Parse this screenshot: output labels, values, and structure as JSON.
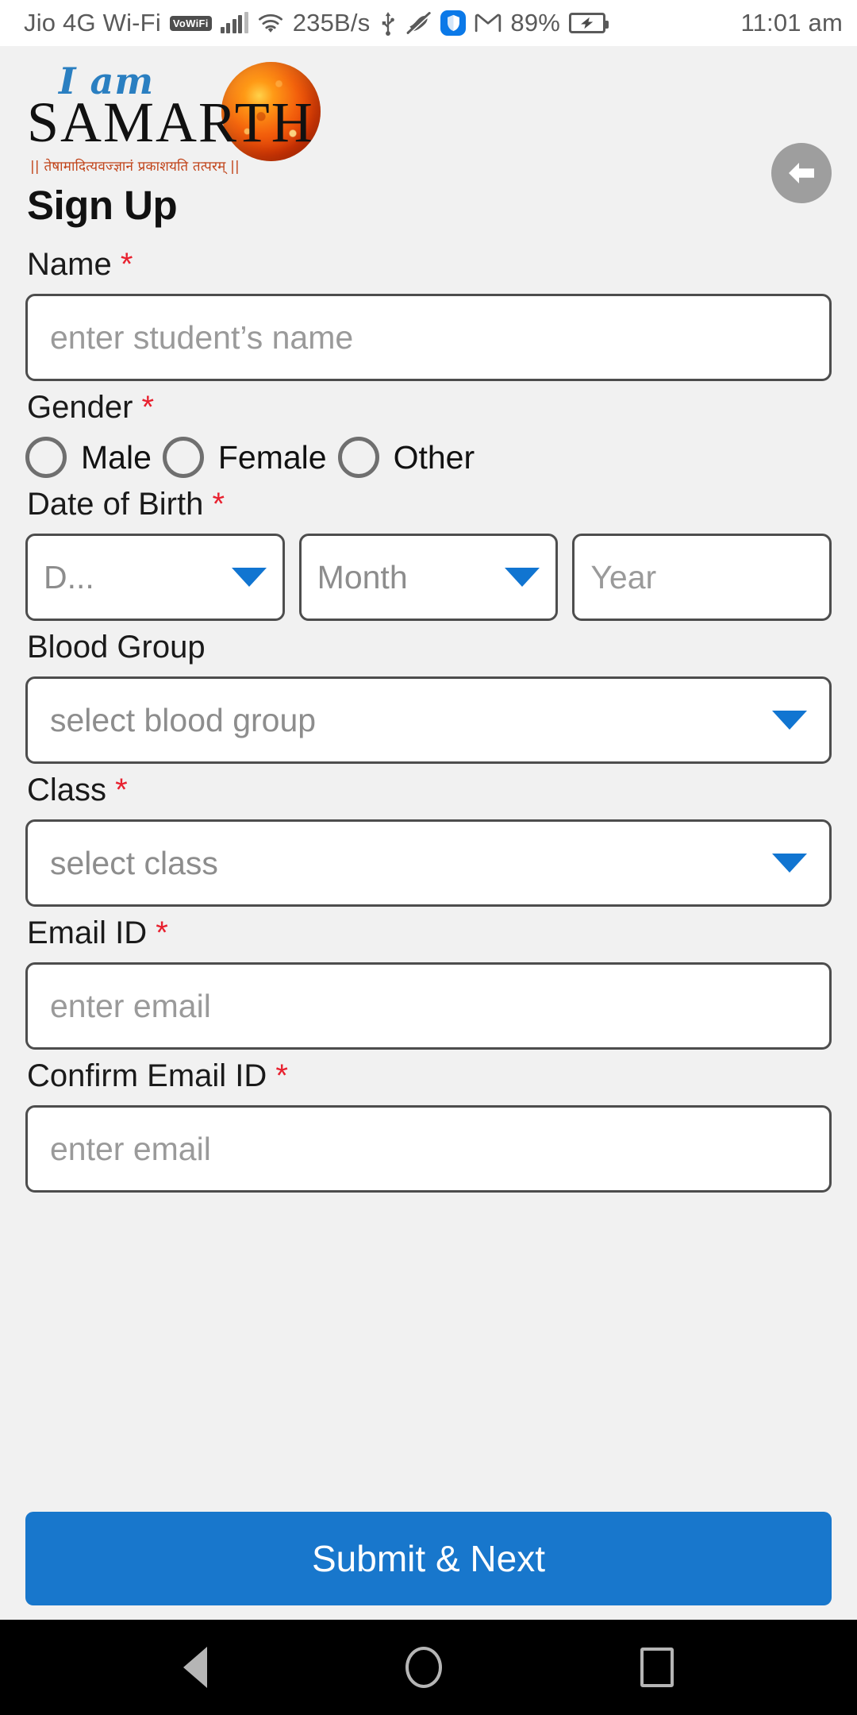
{
  "status_bar": {
    "carrier": "Jio 4G Wi-Fi",
    "vowifi_badge": "VoWiFi",
    "data_rate": "235B/s",
    "battery_percent": "89%",
    "time": "11:01 am",
    "icons": [
      "signal-bars-icon",
      "wifi-icon",
      "usb-icon",
      "mute-icon",
      "shield-icon",
      "gmail-icon",
      "battery-charging-icon"
    ]
  },
  "header": {
    "logo_top": "I am",
    "logo_main": "SAMARTH",
    "logo_sanskrit": "|| तेषामादित्यवज्ज्ञानं प्रकाशयति तत्परम् ||",
    "back_button_label": "Back"
  },
  "form": {
    "title": "Sign Up",
    "required_mark": "*",
    "name": {
      "label": "Name",
      "required": true,
      "placeholder": "enter student’s name",
      "value": ""
    },
    "gender": {
      "label": "Gender",
      "required": true,
      "options": [
        {
          "label": "Male",
          "selected": false
        },
        {
          "label": "Female",
          "selected": false
        },
        {
          "label": "Other",
          "selected": false
        }
      ]
    },
    "date_of_birth": {
      "label": "Date of Birth",
      "required": true,
      "day": {
        "display": "D...",
        "placeholder": "Day",
        "value": ""
      },
      "month": {
        "display": "Month",
        "placeholder": "Month",
        "value": ""
      },
      "year": {
        "display": "Year",
        "placeholder": "Year",
        "value": ""
      }
    },
    "blood_group": {
      "label": "Blood Group",
      "required": false,
      "display": "select blood group",
      "value": ""
    },
    "class": {
      "label": "Class",
      "required": true,
      "display": "select class",
      "value": ""
    },
    "email": {
      "label": "Email ID",
      "required": true,
      "placeholder": "enter email",
      "value": ""
    },
    "confirm_email": {
      "label": "Confirm Email ID",
      "required": true,
      "placeholder": "enter email",
      "value": ""
    },
    "submit_label": "Submit & Next"
  },
  "nav_bar": {
    "back": "back-triangle-icon",
    "home": "home-circle-icon",
    "recents": "recents-square-icon"
  },
  "colors": {
    "accent_blue": "#1877cc",
    "caret_blue": "#1175d1",
    "required_red": "#e8212f",
    "logo_blue": "#2a7fc1",
    "logo_orange": "#e8500a",
    "sanskrit_red": "#c1441a",
    "page_bg": "#f1f1f1",
    "field_border": "#4d4d4d"
  }
}
